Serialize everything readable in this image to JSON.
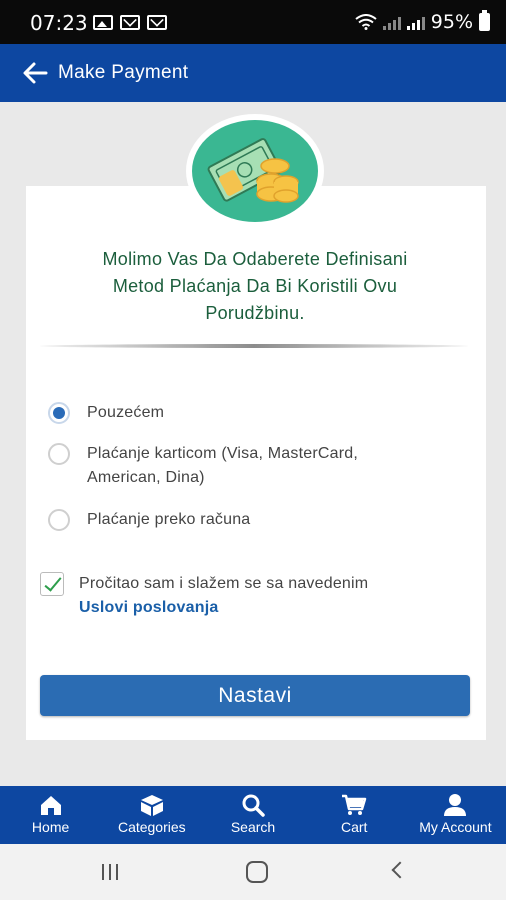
{
  "status_bar": {
    "time": "07:23",
    "battery": "95%",
    "left_icons": [
      "image-icon",
      "mail-icon",
      "mail-icon"
    ],
    "right_icons": [
      "wifi-icon",
      "signal-icon",
      "signal-icon",
      "battery-icon"
    ]
  },
  "app_bar": {
    "title": "Make Payment",
    "back_icon": "arrow-left-icon",
    "color": "#0d47a1"
  },
  "illustration": {
    "icon": "money-cash-coins-icon",
    "color": "#3ab792"
  },
  "payment": {
    "prompt_line1": "Molimo Vas Da Odaberete Definisani",
    "prompt_line2": "Metod Plaćanja Da Bi Koristili Ovu",
    "prompt_line3": "Porudžbinu.",
    "methods": [
      {
        "label": "Pouzećem",
        "selected": true
      },
      {
        "label_line1": "Plaćanje karticom (Visa, MasterCard,",
        "label_line2": "American, Dina)",
        "selected": false
      },
      {
        "label": "Plaćanje preko računa",
        "selected": false
      }
    ],
    "terms_text": "Pročitao sam i slažem se sa navedenim",
    "terms_link": "Uslovi poslovanja",
    "terms_checked": true,
    "continue_label": "Nastavi",
    "accent_color": "#2b6cb3"
  },
  "bottom_nav": {
    "items": [
      {
        "label": "Home",
        "icon": "home-icon"
      },
      {
        "label": "Categories",
        "icon": "categories-icon"
      },
      {
        "label": "Search",
        "icon": "search-icon"
      },
      {
        "label": "Cart",
        "icon": "cart-icon"
      },
      {
        "label": "My Account",
        "icon": "account-icon"
      }
    ]
  },
  "system_nav": {
    "buttons": [
      "recent-apps-icon",
      "home-button-icon",
      "back-button-icon"
    ]
  }
}
